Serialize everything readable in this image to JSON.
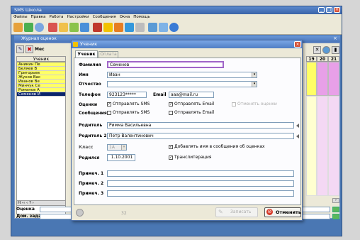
{
  "app": {
    "title": "SMS Школа"
  },
  "menu": [
    "Файлы",
    "Правка",
    "Работа",
    "Настройки",
    "Сообщения",
    "Окна",
    "Помощь"
  ],
  "journal": {
    "title": "Журнал оценок",
    "month_label": "Мес",
    "list_header": "Ученик",
    "students": [
      "Аникин Пе",
      "Беляев В",
      "Григорьев",
      "Жуков Вас",
      "Иванов Ве",
      "Минчук Се",
      "Романов А",
      "Семенов И"
    ],
    "day_headers": [
      "19",
      "20",
      "21"
    ],
    "nav": "H ‹‹ ‹ ? ›",
    "grade_label": "Оценка",
    "homework_label": "Дом. задание"
  },
  "dialog": {
    "title": "Ученик",
    "tabs": [
      "Ученик",
      "Оплата"
    ],
    "labels": {
      "last_name": "Фамилия",
      "first_name": "Имя",
      "middle_name": "Отчество",
      "phone": "Телефон",
      "email": "Email",
      "grades": "Оценки",
      "messages": "Сообщения",
      "parent1": "Родитель",
      "parent2": "Родитель 2",
      "class": "Класс",
      "born": "Родился",
      "note1": "Примеч. 1",
      "note2": "Примеч. 2",
      "note3": "Примеч. 3"
    },
    "values": {
      "last_name": "Семенов",
      "first_name": "Иван",
      "middle_name": "",
      "phone": "923123*****",
      "email": "aaa@mail.ru",
      "parent1": "Римма Васильевна",
      "parent2": "Петр Валентинович",
      "class": "1А",
      "born": "1.10.2001"
    },
    "checkboxes": {
      "send_sms": "Отправлять SMS",
      "send_email": "Отправлять Email",
      "cancel_grades": "Отменять оценки",
      "add_name": "Добавлять имя в сообщения об оценках",
      "transliteration": "Транслитерация"
    },
    "footer": {
      "counter": "32",
      "save": "Записать",
      "cancel": "Отменить"
    }
  },
  "colors": {
    "accent": "#a066c8",
    "highlight": "#ffff66",
    "selection": "#0a246a"
  }
}
